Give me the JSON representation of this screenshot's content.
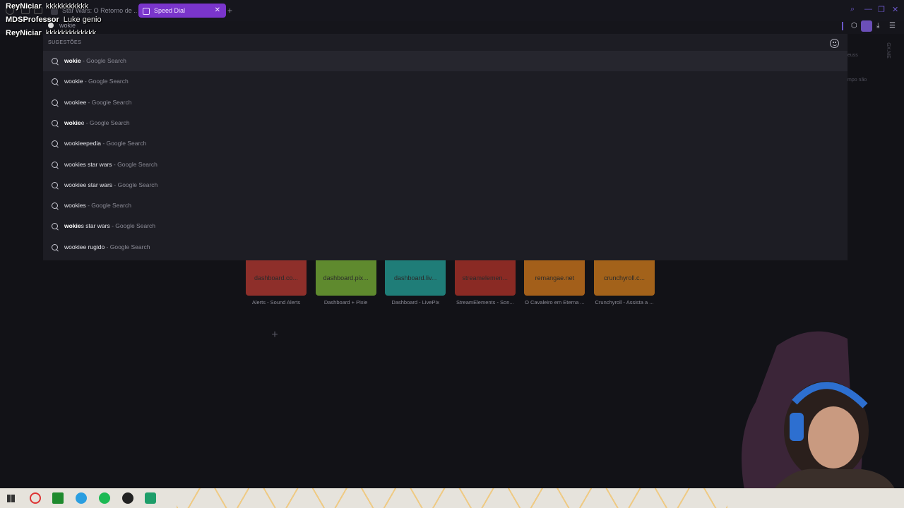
{
  "colors": {
    "accent": "#7a35cc",
    "panel": "#1d1d24",
    "background": "#121217"
  },
  "tabs": [
    {
      "label": "Star Wars: O Retorno de ..."
    },
    {
      "label": "Speed Dial",
      "active": true
    }
  ],
  "address_bar": {
    "value": "wokie"
  },
  "chat": [
    {
      "user": "ReyNiciar",
      "message": "kkkkkkkkkkk"
    },
    {
      "user": "MDSProfessor",
      "message": "Luke genio"
    },
    {
      "user": "ReyNiciar",
      "message": "kkkkkkkkkkkkk"
    }
  ],
  "suggestions": {
    "title": "SUGESTÕES",
    "items": [
      {
        "bold": "wokie",
        "rest": "",
        "source": " - Google Search"
      },
      {
        "bold": "",
        "rest": "wookie",
        "source": " - Google Search"
      },
      {
        "bold": "",
        "rest": "wookiee",
        "source": " - Google Search"
      },
      {
        "bold": "wokie",
        "rest": "e",
        "source": " - Google Search"
      },
      {
        "bold": "",
        "rest": "wookieepedia",
        "source": " - Google Search"
      },
      {
        "bold": "",
        "rest": "wookies star wars",
        "source": " - Google Search"
      },
      {
        "bold": "",
        "rest": "wookiee star wars",
        "source": " - Google Search"
      },
      {
        "bold": "",
        "rest": "wookies",
        "source": " - Google Search"
      },
      {
        "bold": "wokie",
        "rest": "s star wars",
        "source": " - Google Search"
      },
      {
        "bold": "",
        "rest": "wookiee rugido",
        "source": " - Google Search"
      }
    ]
  },
  "speed_dial": [
    {
      "thumb": "dashboard.co...",
      "caption": "Alerts - Sound Alerts",
      "color": "#8e2f2a"
    },
    {
      "thumb": "dashboard.pix...",
      "caption": "Dashboard + Pixie",
      "color": "#5f8a2e"
    },
    {
      "thumb": "dashboard.liv...",
      "caption": "Dashboard - LivePix",
      "color": "#1f7d78"
    },
    {
      "thumb": "streamelemen...",
      "caption": "StreamElements - Son...",
      "color": "#8a2a24"
    },
    {
      "thumb": "remangae.net",
      "caption": "O Cavaleiro em Eterna ...",
      "color": "#a35f1a"
    },
    {
      "thumb": "crunchyroll.c...",
      "caption": "Crunchyroll - Assista a ...",
      "color": "#a3621a"
    }
  ],
  "add_dial": "+",
  "sidebar_ghost": [
    "euss",
    "GX.ME",
    "mpo não"
  ],
  "icons": {
    "search": "search-icon",
    "smiley": "feedback-smiley-icon"
  }
}
